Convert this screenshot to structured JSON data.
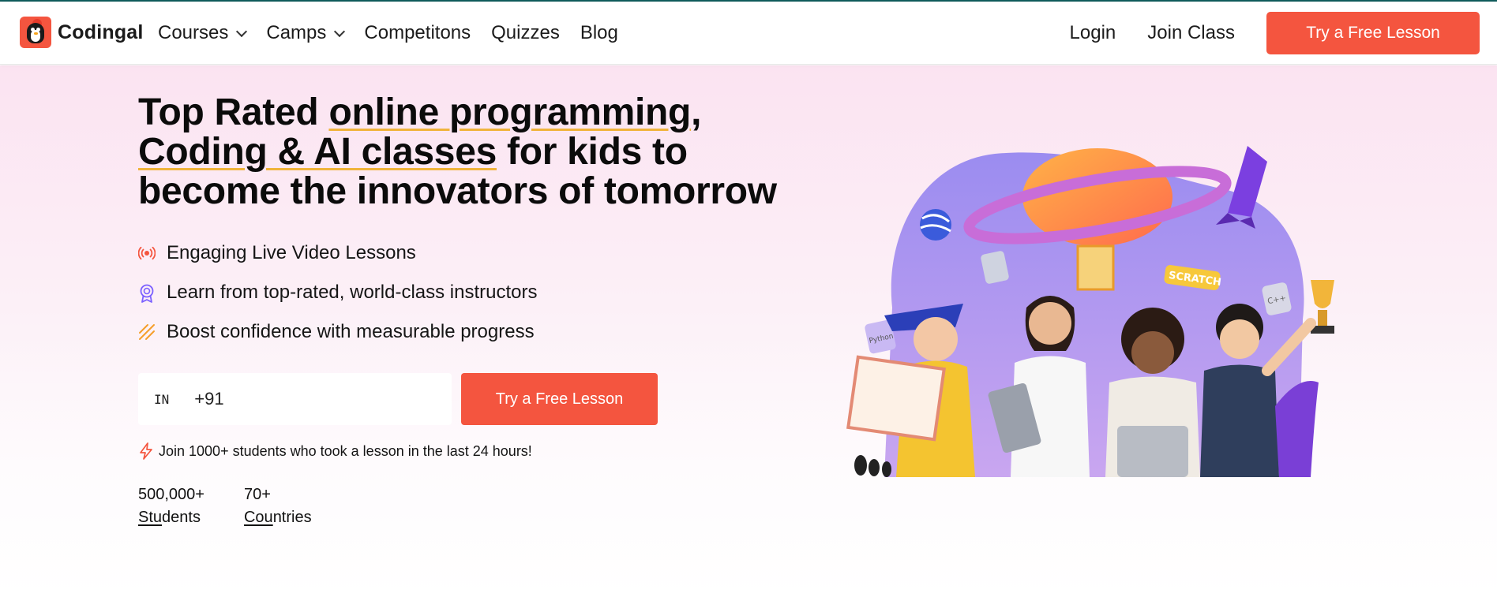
{
  "brand": {
    "name": "Codingal"
  },
  "nav": {
    "items": [
      {
        "label": "Courses",
        "has_dropdown": true
      },
      {
        "label": "Camps",
        "has_dropdown": true
      },
      {
        "label": "Competitons",
        "has_dropdown": false
      },
      {
        "label": "Quizzes",
        "has_dropdown": false
      },
      {
        "label": "Blog",
        "has_dropdown": false
      }
    ],
    "login": "Login",
    "join_class": "Join Class",
    "cta": "Try a Free Lesson"
  },
  "hero": {
    "headline": {
      "part1": "Top Rated ",
      "hl1": "online programming",
      "part2": ",",
      "hl2": "Coding & AI classes",
      "part3": " for kids to become the innovators of tomorrow"
    },
    "features": [
      {
        "icon": "live-broadcast-icon",
        "text": "Engaging Live Video Lessons"
      },
      {
        "icon": "award-ribbon-icon",
        "text": "Learn from top-rated, world-class instructors"
      },
      {
        "icon": "progress-stripes-icon",
        "text": "Boost confidence with measurable progress"
      }
    ],
    "form": {
      "country_code": "IN",
      "phone_value": "+91",
      "cta": "Try a Free Lesson"
    },
    "social_proof": "Join 1000+ students who took a lesson in the last 24 hours!",
    "stats": [
      {
        "value": "500,000+",
        "label_ul": "Stu",
        "label_rest": "dents"
      },
      {
        "value": "70+",
        "label_ul": "Cou",
        "label_rest": "ntries"
      }
    ],
    "illustration_labels": {
      "scratch_badge": "SCRATCH",
      "python_card": "Python",
      "cpp_card": "C++"
    }
  },
  "colors": {
    "brand_accent": "#f4553f",
    "highlight_underline": "#f0b43c",
    "topline": "#0f5a5a",
    "hero_bg_top": "#fbe3f1"
  }
}
